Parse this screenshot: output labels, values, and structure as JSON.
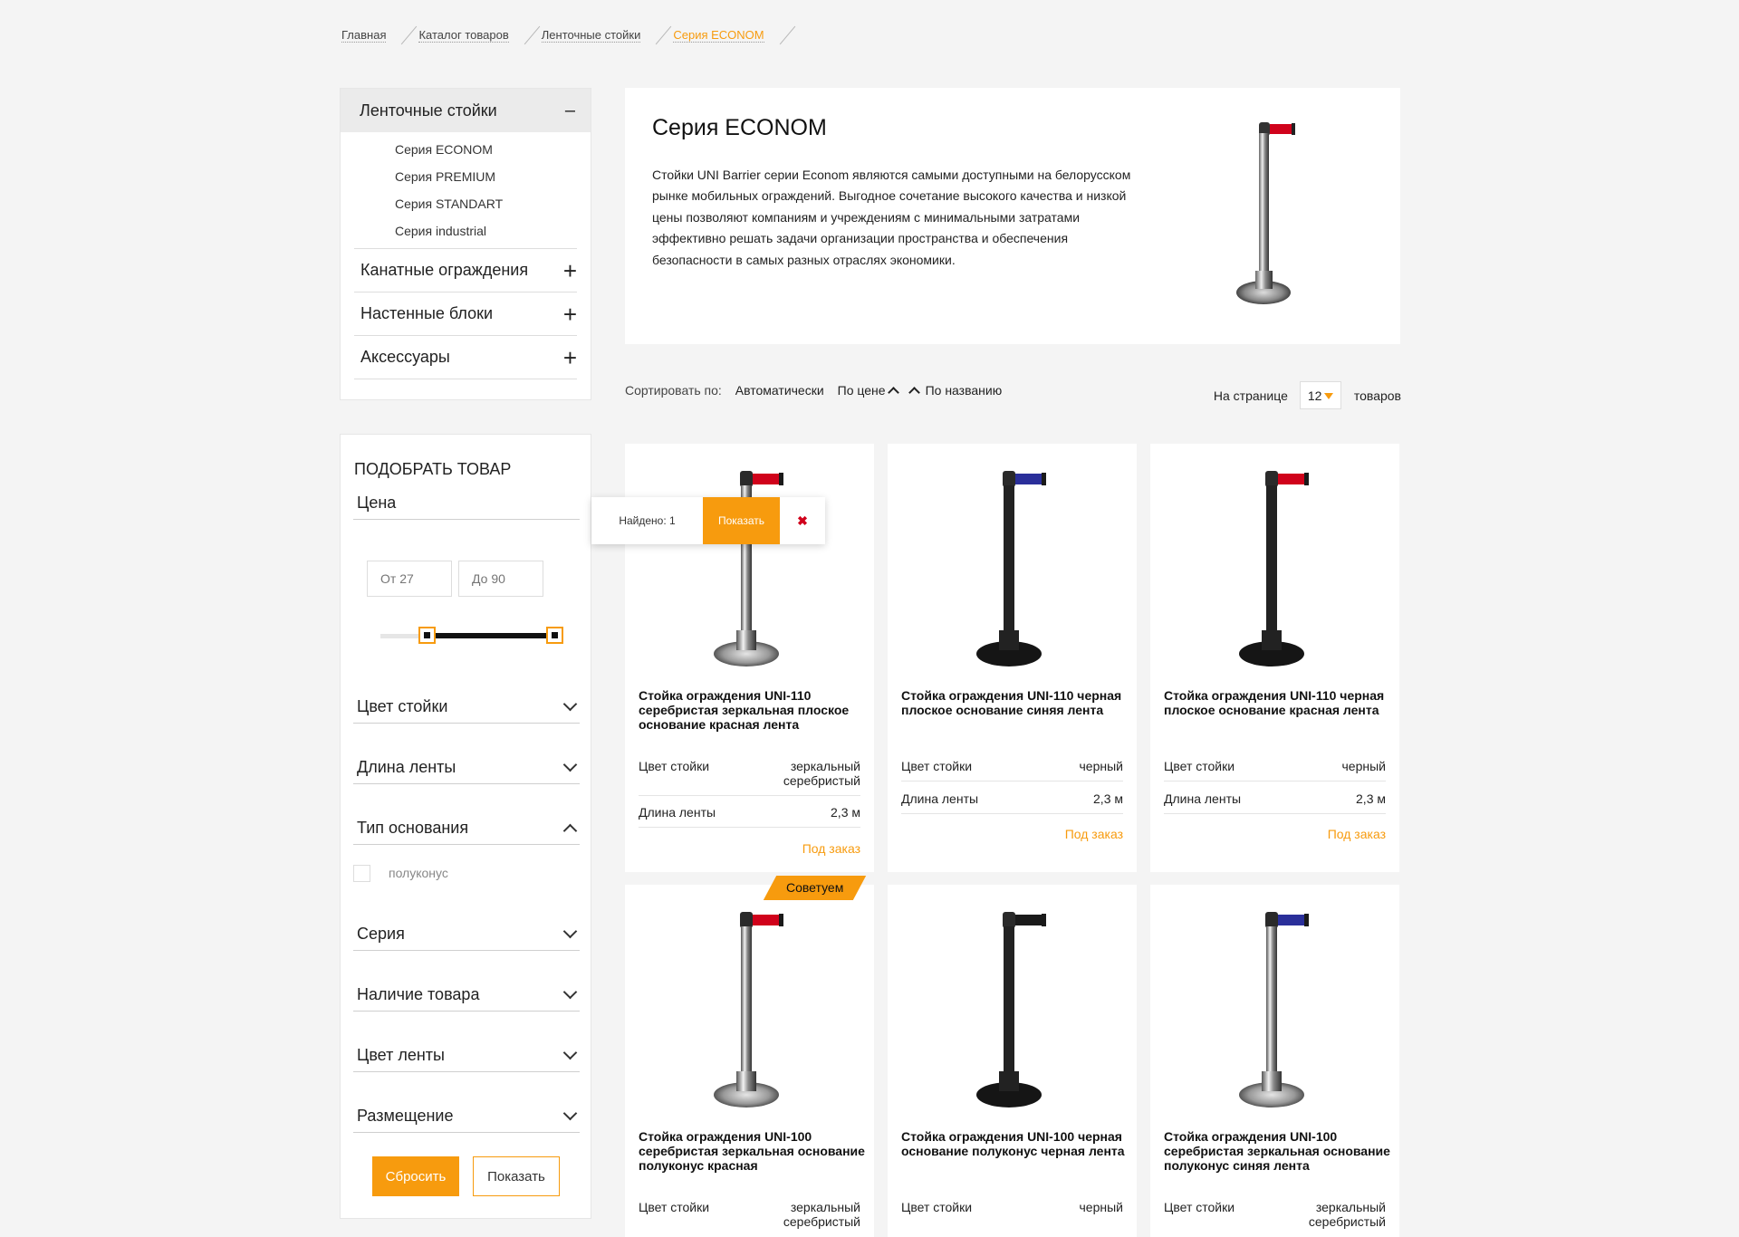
{
  "breadcrumb": [
    "Главная",
    "Каталог товаров",
    "Ленточные стойки",
    "Серия ECONOM"
  ],
  "catalog_menu": {
    "active": "Ленточные стойки",
    "active_toggle": "–",
    "subitems": [
      "Серия ECONOM",
      "Серия PREMIUM",
      "Серия STANDART",
      "Серия industrial"
    ],
    "categories": [
      "Канатные ограждения",
      "Настенные блоки",
      "Аксессуары"
    ]
  },
  "filter": {
    "title": "ПОДОБРАТЬ ТОВАР",
    "price_label": "Цена",
    "price_from": "От 27",
    "price_to": "До 90",
    "sections": [
      "Цвет стойки",
      "Длина ленты",
      "Тип основания",
      "Серия",
      "Наличие товара",
      "Цвет ленты",
      "Размещение"
    ],
    "base_option": "полуконус",
    "reset": "Сбросить",
    "show": "Показать"
  },
  "popup": {
    "found": "Найдено: 1",
    "show": "Показать",
    "close": "✖"
  },
  "intro": {
    "title": "Серия ECONOM",
    "text": "Стойки UNI Barrier серии Econom являются самыми доступными на белорусском рынке мобильных ограждений. Выгодное сочетание высокого качества и низкой цены позволяют компаниям и учреждениям с минимальными затратами эффективно решать задачи организации пространства и обеспечения безопасности  в самых разных отраслях экономики."
  },
  "sort": {
    "label": "Сортировать по:",
    "auto": "Автоматически",
    "price": "По цене",
    "name": "По названию",
    "per_page_label": "На странице",
    "per_page": "12",
    "per_page_suffix": "товаров"
  },
  "colors": {
    "accent": "#f79b0e",
    "red_tape": "#d0021b",
    "blue_tape": "#2a2f9a"
  },
  "products": [
    {
      "title": "Стойка ограждения UNI-110 серебристая зеркальная плоское основание красная лента",
      "color_label": "Цвет стойки",
      "color": "зеркальный серебристый",
      "len_label": "Длина ленты",
      "len": "2,3 м",
      "status": "Под заказ",
      "post": "chrome",
      "tape": "red"
    },
    {
      "title": "Стойка ограждения UNI-110 черная плоское основание синяя лента",
      "color_label": "Цвет стойки",
      "color": "черный",
      "len_label": "Длина ленты",
      "len": "2,3 м",
      "status": "Под заказ",
      "post": "black",
      "tape": "blue"
    },
    {
      "title": "Стойка ограждения UNI-110 черная плоское основание красная лента",
      "color_label": "Цвет стойки",
      "color": "черный",
      "len_label": "Длина ленты",
      "len": "2,3 м",
      "status": "Под заказ",
      "post": "black",
      "tape": "red"
    },
    {
      "title": "Стойка ограждения UNI-100 серебристая зеркальная основание полуконус красная",
      "color_label": "Цвет стойки",
      "color": "зеркальный серебристый",
      "badge": "Советуем",
      "post": "chrome",
      "tape": "red"
    },
    {
      "title": "Стойка ограждения UNI-100 черная основание полуконус черная лента",
      "color_label": "Цвет стойки",
      "color": "черный",
      "post": "black",
      "tape": "black"
    },
    {
      "title": "Стойка ограждения UNI-100 серебристая зеркальная основание полуконус синяя лента",
      "color_label": "Цвет стойки",
      "color": "зеркальный серебристый",
      "post": "chrome",
      "tape": "blue"
    }
  ]
}
